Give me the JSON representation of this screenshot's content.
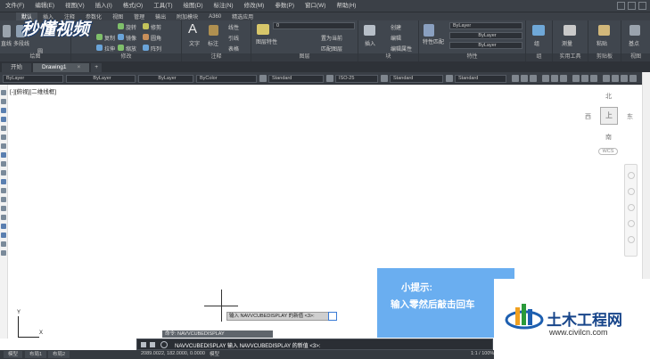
{
  "menubar": {
    "items": [
      "文件(F)",
      "编辑(E)",
      "视图(V)",
      "插入(I)",
      "格式(O)",
      "工具(T)",
      "绘图(D)",
      "标注(N)",
      "修改(M)",
      "参数(P)",
      "窗口(W)",
      "帮助(H)"
    ]
  },
  "ribbon": {
    "tabs": [
      "默认",
      "插入",
      "注释",
      "参数化",
      "视图",
      "管理",
      "输出",
      "附加模块",
      "A360",
      "精选应用"
    ],
    "active_tab": "默认",
    "buttons": {
      "line": "直线",
      "polyline": "多段线",
      "circle": "圆",
      "move": "移动",
      "rotate": "旋转",
      "trim": "修剪",
      "copy": "复制",
      "mirror": "镜像",
      "fillet": "圆角",
      "stretch": "拉伸",
      "scale": "缩放",
      "array": "阵列",
      "text": "文字",
      "dimension": "标注",
      "linear": "线性",
      "leader": "引线",
      "table": "表格",
      "layer_props": "图层特性",
      "make_current": "置为当前",
      "match_layer": "匹配图层",
      "insert": "插入",
      "create": "创建",
      "edit": "编辑",
      "edit_attr": "编辑属性",
      "match_props": "特性匹配",
      "group": "组",
      "measure": "测量",
      "paste": "粘贴",
      "base": "基点"
    },
    "layer_value": "0",
    "bylayer_color": "ByLayer",
    "bylayer_linetype": "ByLayer",
    "bylayer_lineweight": "ByLayer",
    "panels": [
      "绘图",
      "修改",
      "注释",
      "图层",
      "块",
      "特性",
      "组",
      "实用工具",
      "剪贴板",
      "视图"
    ]
  },
  "filetabs": {
    "start": "开始",
    "drawing": "Drawing1",
    "close": "×",
    "add": "+"
  },
  "proptb": {
    "color": "ByLayer",
    "linetype": "ByLayer",
    "lineweight": "ByLayer",
    "plotstyle": "ByColor",
    "textstyle": "Standard",
    "dimstyle": "ISO-25",
    "tablestyle": "Standard",
    "mleaderstyle": "Standard"
  },
  "canvas": {
    "viewport_label": "[-][俯视][二维线框]"
  },
  "viewcube": {
    "north": "北",
    "south": "南",
    "west": "西",
    "east": "东",
    "top_face": "上",
    "wcs": "WCS"
  },
  "dynamic_input": {
    "prompt": "输入 NAVVCUBEDISPLAY 的新值 <3>:"
  },
  "ucs": {
    "y": "Y",
    "x": "X"
  },
  "tip": {
    "title": "小提示:",
    "body": "输入零然后敲击回车"
  },
  "commandline": {
    "history": "命令: NAVVCUBEDISPLAY",
    "current": "NAVVCUBEDISPLAY 输入 NAVVCUBEDISPLAY 的新值 <3>:"
  },
  "statusbar": {
    "layouts": [
      "模型",
      "布局1",
      "布局2"
    ],
    "coords": "2089.0022, 182.0000, 0.0000",
    "model_label": "模型",
    "scale": "1:1 / 100%"
  },
  "logos": {
    "left": "秒懂视频",
    "right_title": "土木工程网",
    "right_url": "www.civilcn.com"
  },
  "colors": {
    "dark_ui": "#3b4047",
    "tip_blue": "#6aaef0",
    "logo_blue": "#17458a",
    "canvas": "#ffffff"
  }
}
